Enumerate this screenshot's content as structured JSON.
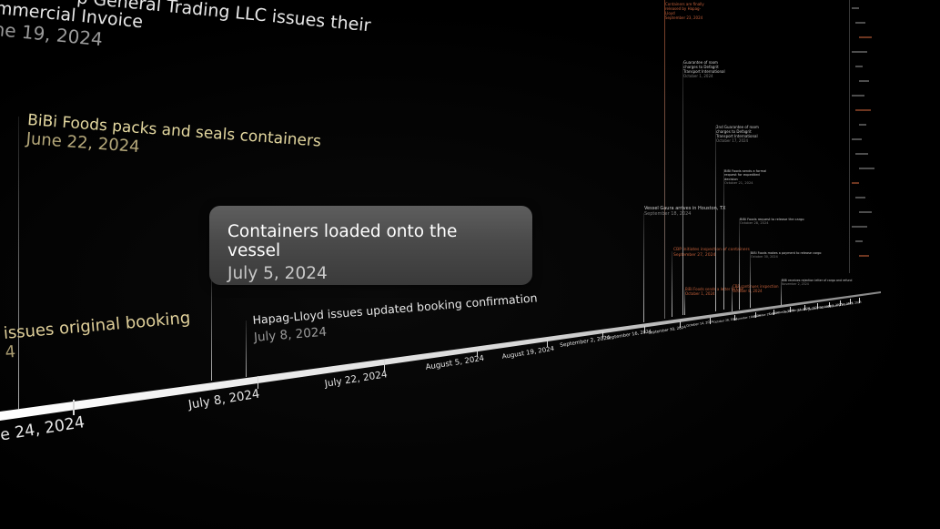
{
  "timeline": {
    "events": [
      {
        "id": "commercial-invoice",
        "title_line1": "p General Trading LLC issues their",
        "title_line2": "mmercial Invoice",
        "date": "ne 19, 2024"
      },
      {
        "id": "packs-seals",
        "title": "BiBi Foods packs and seals containers",
        "date": "June 22, 2024"
      },
      {
        "id": "original-booking",
        "title": "issues original booking",
        "date": "4"
      },
      {
        "id": "updated-booking",
        "title": "Hapag-Lloyd issues updated booking confirmation",
        "date": "July 8, 2024"
      },
      {
        "id": "vessel-houston",
        "title": "Vessel Gaura arrives in Houston, TX",
        "date": "September 18, 2024"
      },
      {
        "id": "cbp-inspection",
        "title": "CBP initiates inspection of containers",
        "date": "September 27, 2024"
      },
      {
        "id": "bibi-letter-cbp",
        "title": "BiBi Foods sends a letter to CBP",
        "date": "October 1, 2024"
      },
      {
        "id": "cbp-continues",
        "title": "CBP continues inspection",
        "date": "October 8, 2024"
      },
      {
        "id": "guarantee-charges-1",
        "title": "Guarantee of room charges to Defagrit Transport International",
        "date": "October 1, 2024"
      },
      {
        "id": "guarantee-charges-2",
        "title": "2nd Guarantee of room charges to Defagrit Transport International",
        "date": "October 17, 2024"
      },
      {
        "id": "bibi-formal-request",
        "title": "BiBi Foods sends a formal request for expedited decision",
        "date": "October 21, 2024"
      },
      {
        "id": "bibi-request-release",
        "title": "BiBi Foods request to release the cargo",
        "date": "October 28, 2024"
      },
      {
        "id": "bibi-foods-makes",
        "title": "BiBi Foods makes a payment to release cargo",
        "date": "October 30, 2024"
      },
      {
        "id": "bibi-rejection",
        "title": "BiBi receives rejection letter of cargo and refund",
        "date": "November 2, 2024"
      },
      {
        "id": "containers-released",
        "title": "Containers are finally released by Hapag-Lloyd",
        "date": "September 23, 2024"
      }
    ],
    "axis_labels": [
      "June 24, 2024",
      "July 8, 2024",
      "July 22, 2024",
      "August 5, 2024",
      "August 19, 2024",
      "September 2, 2024",
      "September 16, 2024",
      "September 30, 2024",
      "October 14, 2024",
      "October 28, 2024",
      "November 11, 2024",
      "November 25, 2024",
      "December 9, 2024",
      "December 23, 2024",
      "January 6, 2025",
      "January 20, 2025",
      "February 3, 2025",
      "February 17, 2025",
      "March 3, 2025"
    ]
  },
  "tooltip": {
    "title": "Containers loaded onto the vessel",
    "date": "July 5, 2024"
  },
  "colors": {
    "background": "#000000",
    "text": "#e8e8e8",
    "date": "#9a9a9a",
    "accent_orange": "#c8623a",
    "tooltip_bg": "#4a4a4a"
  }
}
